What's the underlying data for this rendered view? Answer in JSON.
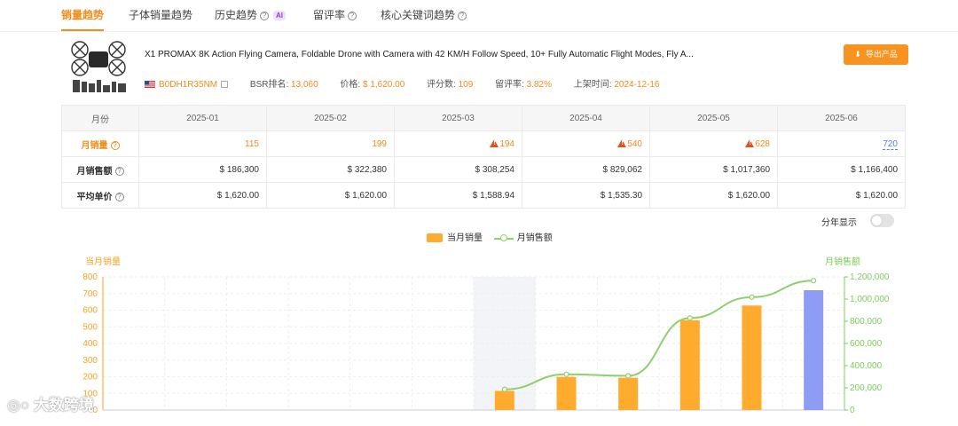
{
  "tabs": [
    {
      "label": "销量趋势",
      "active": true
    },
    {
      "label": "子体销量趋势"
    },
    {
      "label": "历史趋势",
      "ai": "AI"
    },
    {
      "label": "留评率"
    },
    {
      "label": "核心关键词趋势"
    }
  ],
  "product": {
    "title": "X1 PROMAX 8K Action Flying Camera, Foldable Drone with Camera with 42 KM/H Follow Speed, 10+ Fully Automatic Flight Modes, Fly A...",
    "asin": "B0DH1R35NM",
    "bsr_label": "BSR排名:",
    "bsr_value": "13,060",
    "price_label": "价格:",
    "price_value": "$ 1,620.00",
    "rating_label": "评分数:",
    "rating_value": "109",
    "review_rate_label": "留评率:",
    "review_rate_value": "3.82%",
    "listed_label": "上架时间:",
    "listed_value": "2024-12-16",
    "export_label": "导出产品"
  },
  "table": {
    "header_label": "月份",
    "months": [
      "2025-01",
      "2025-02",
      "2025-03",
      "2025-04",
      "2025-05",
      "2025-06"
    ],
    "rows": [
      {
        "label": "月销量",
        "values": [
          "115",
          "199",
          "194",
          "540",
          "628",
          "720"
        ],
        "warn": [
          false,
          false,
          true,
          true,
          true,
          false
        ]
      },
      {
        "label": "月销售额",
        "values": [
          "$ 186,300",
          "$ 322,380",
          "$ 308,254",
          "$ 829,062",
          "$ 1,017,360",
          "$ 1,166,400"
        ]
      },
      {
        "label": "平均单价",
        "values": [
          "$ 1,620.00",
          "$ 1,620.00",
          "$ 1,588.94",
          "$ 1,535.30",
          "$ 1,620.00",
          "$ 1,620.00"
        ]
      }
    ]
  },
  "toggle": {
    "label": "分年显示",
    "on": false
  },
  "watermark": "大数跨境",
  "chart_data": {
    "type": "bar",
    "legend": [
      "当月销量",
      "月销售额"
    ],
    "y_left_label": "当月销量",
    "y_right_label": "月销售额",
    "y_left_ticks": [
      "0",
      "100",
      "200",
      "300",
      "400",
      "500",
      "600",
      "700",
      "800"
    ],
    "y_right_ticks": [
      "0",
      "200,000",
      "400,000",
      "600,000",
      "800,000",
      "1,000,000",
      "1,200,000"
    ],
    "ylim_left": [
      0,
      800
    ],
    "ylim_right": [
      0,
      1200000
    ],
    "x_count": 12,
    "bars": [
      {
        "index": 6,
        "value": 115
      },
      {
        "index": 7,
        "value": 199
      },
      {
        "index": 8,
        "value": 194
      },
      {
        "index": 9,
        "value": 540
      },
      {
        "index": 10,
        "value": 628
      },
      {
        "index": 11,
        "value": 720
      }
    ],
    "line": [
      {
        "index": 6,
        "value": 186300
      },
      {
        "index": 7,
        "value": 322380
      },
      {
        "index": 8,
        "value": 308254
      },
      {
        "index": 9,
        "value": 829062
      },
      {
        "index": 10,
        "value": 1017360
      },
      {
        "index": 11,
        "value": 1166400
      }
    ],
    "highlight_index": 6,
    "colors": {
      "bar": "#ffab2e",
      "bar_current": "#8f9cf3",
      "line": "#8dd16e",
      "left_axis": "#f7a326",
      "right_axis": "#7ccc58",
      "highlight": "#f3f4f8"
    }
  }
}
